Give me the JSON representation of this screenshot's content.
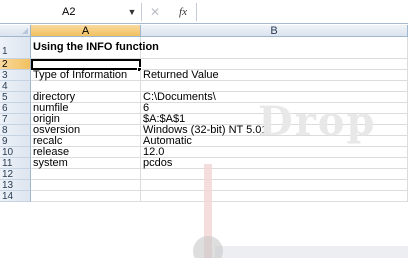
{
  "formula_bar": {
    "name_box": "A2",
    "name_box_dropdown": "▼",
    "cancel_glyph": "✕",
    "fx_label": "fx",
    "formula": ""
  },
  "grid": {
    "columns": [
      "A",
      "B"
    ],
    "rows": [
      {
        "num": "1",
        "a": "Using the INFO function",
        "b": ""
      },
      {
        "num": "2",
        "a": "",
        "b": ""
      },
      {
        "num": "3",
        "a": "Type of Information",
        "b": "Returned Value"
      },
      {
        "num": "4",
        "a": "",
        "b": ""
      },
      {
        "num": "5",
        "a": "directory",
        "b": "C:\\Documents\\"
      },
      {
        "num": "6",
        "a": "numfile",
        "b": "6"
      },
      {
        "num": "7",
        "a": "origin",
        "b": "$A:$A$1"
      },
      {
        "num": "8",
        "a": "osversion",
        "b": "Windows (32-bit) NT 5.01"
      },
      {
        "num": "9",
        "a": "recalc",
        "b": "Automatic"
      },
      {
        "num": "10",
        "a": "release",
        "b": "12.0"
      },
      {
        "num": "11",
        "a": "system",
        "b": "pcdos"
      },
      {
        "num": "12",
        "a": "",
        "b": ""
      },
      {
        "num": "13",
        "a": "",
        "b": ""
      },
      {
        "num": "14",
        "a": "",
        "b": ""
      }
    ]
  },
  "watermark": "Drop",
  "colors": {
    "header_bg": "#dbe3ee",
    "selected_header": "#f1c15f",
    "gridline": "#dadcdd"
  }
}
